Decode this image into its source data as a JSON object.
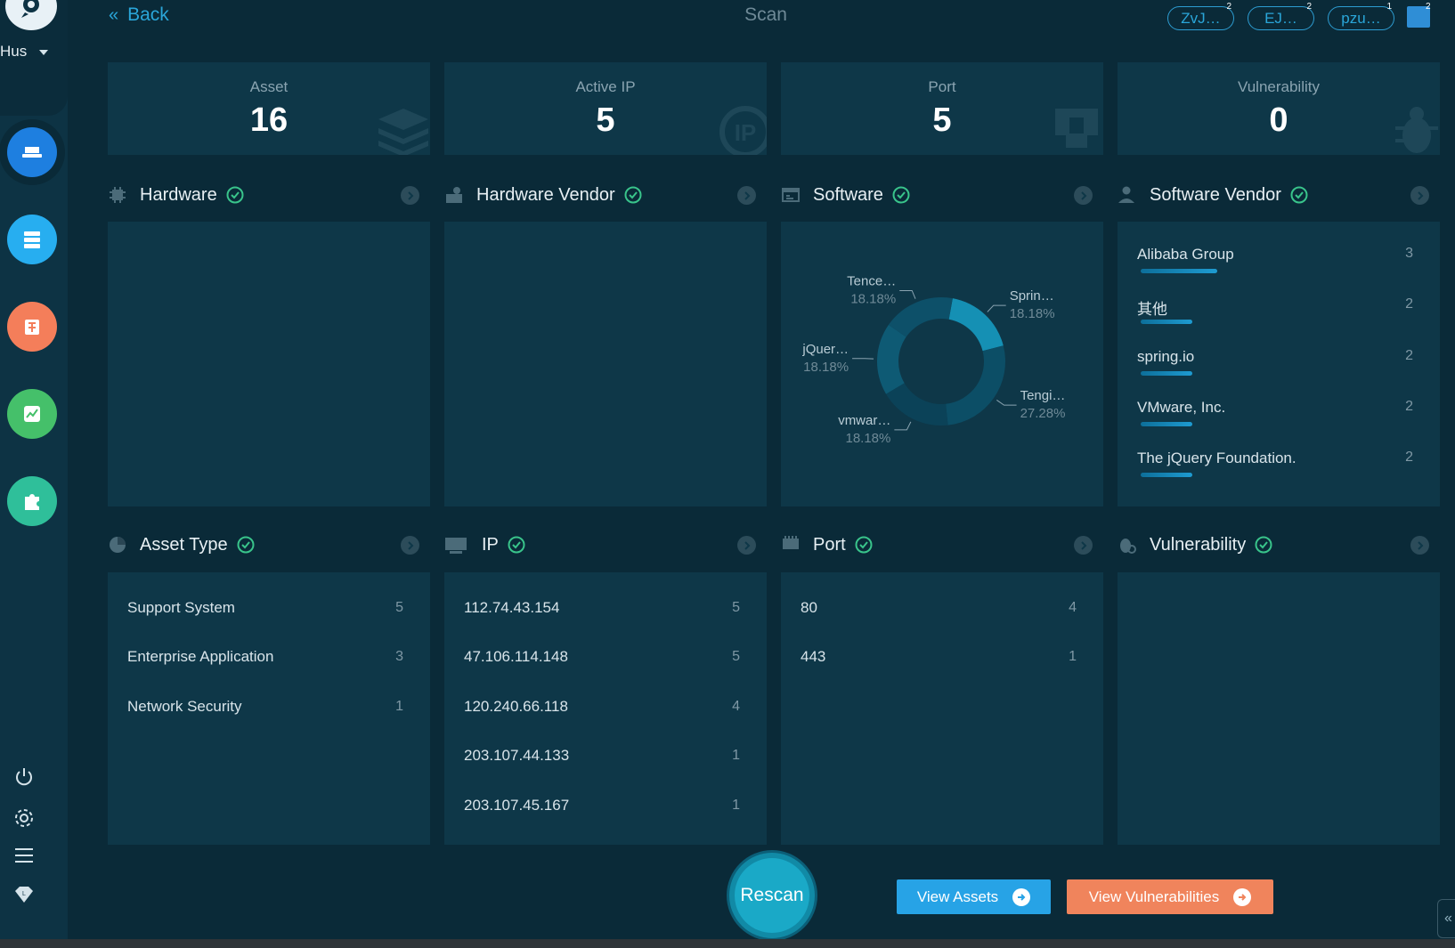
{
  "header": {
    "back_label": "Back",
    "title": "Scan",
    "pills": [
      {
        "label": "ZvJ…",
        "badge": "2"
      },
      {
        "label": "EJ…",
        "badge": "2"
      },
      {
        "label": "pzu…",
        "badge": "1"
      }
    ],
    "square_badge": "2"
  },
  "sidebar": {
    "user_name": "Hus",
    "nav": [
      {
        "name": "assets",
        "icon": "hat-icon",
        "color": "#1e7fe0"
      },
      {
        "name": "servers",
        "icon": "server-icon",
        "color": "#27aef0"
      },
      {
        "name": "vulnerabilities",
        "icon": "bug-icon",
        "color": "#f47e5a"
      },
      {
        "name": "monitor",
        "icon": "chart-icon",
        "color": "#45c06a"
      },
      {
        "name": "plugins",
        "icon": "puzzle-icon",
        "color": "#2fbf9a"
      }
    ],
    "utilities": [
      "power-icon",
      "gear-icon",
      "menu-icon",
      "diamond-icon"
    ]
  },
  "stats": [
    {
      "label": "Asset",
      "value": "16"
    },
    {
      "label": "Active IP",
      "value": "5"
    },
    {
      "label": "Port",
      "value": "5"
    },
    {
      "label": "Vulnerability",
      "value": "0"
    }
  ],
  "sections": {
    "hardware": {
      "title": "Hardware"
    },
    "hardware_vendor": {
      "title": "Hardware Vendor"
    },
    "software": {
      "title": "Software"
    },
    "software_vendor": {
      "title": "Software Vendor",
      "items": [
        {
          "label": "Alibaba Group",
          "count": "3",
          "share": 0.6
        },
        {
          "label": "其他",
          "count": "2",
          "share": 0.4
        },
        {
          "label": "spring.io",
          "count": "2",
          "share": 0.4
        },
        {
          "label": "VMware, Inc.",
          "count": "2",
          "share": 0.4
        },
        {
          "label": "The jQuery Foundation.",
          "count": "2",
          "share": 0.4
        }
      ]
    },
    "asset_type": {
      "title": "Asset Type",
      "items": [
        {
          "label": "Support System",
          "count": "5"
        },
        {
          "label": "Enterprise Application",
          "count": "3"
        },
        {
          "label": "Network Security",
          "count": "1"
        }
      ]
    },
    "ip": {
      "title": "IP",
      "items": [
        {
          "label": "112.74.43.154",
          "count": "5"
        },
        {
          "label": "47.106.114.148",
          "count": "5"
        },
        {
          "label": "120.240.66.118",
          "count": "4"
        },
        {
          "label": "203.107.44.133",
          "count": "1"
        },
        {
          "label": "203.107.45.167",
          "count": "1"
        }
      ]
    },
    "port": {
      "title": "Port",
      "items": [
        {
          "label": "80",
          "count": "4"
        },
        {
          "label": "443",
          "count": "1"
        }
      ]
    },
    "vulnerability": {
      "title": "Vulnerability"
    }
  },
  "chart_data": {
    "type": "pie",
    "donut": true,
    "slices": [
      {
        "label": "Sprin…",
        "percent_label": "18.18%",
        "value": 18.18,
        "color": "#1590b4"
      },
      {
        "label": "Tengi…",
        "percent_label": "27.28%",
        "value": 27.28,
        "color": "#0c4e66"
      },
      {
        "label": "vmwar…",
        "percent_label": "18.18%",
        "value": 18.18,
        "color": "#0b4258"
      },
      {
        "label": "jQuer…",
        "percent_label": "18.18%",
        "value": 18.18,
        "color": "#0e5a74"
      },
      {
        "label": "Tence…",
        "percent_label": "18.18%",
        "value": 18.18,
        "color": "#0d5069"
      }
    ]
  },
  "actions": {
    "rescan_label": "Rescan",
    "view_assets_label": "View Assets",
    "view_vulns_label": "View Vulnerabilities",
    "collapse_label": "«"
  }
}
